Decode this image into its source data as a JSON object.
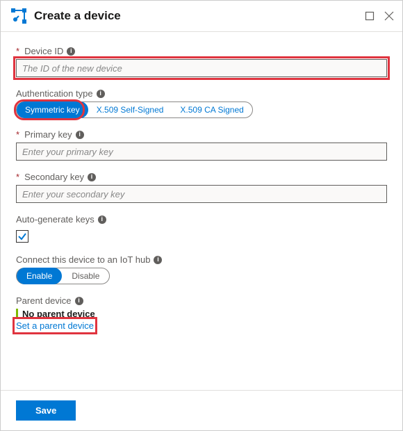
{
  "header": {
    "title": "Create a device"
  },
  "device_id": {
    "label": "Device ID",
    "placeholder": "The ID of the new device",
    "required": true
  },
  "auth_type": {
    "label": "Authentication type",
    "options": [
      "Symmetric key",
      "X.509 Self-Signed",
      "X.509 CA Signed"
    ],
    "selected": "Symmetric key"
  },
  "primary_key": {
    "label": "Primary key",
    "placeholder": "Enter your primary key",
    "required": true
  },
  "secondary_key": {
    "label": "Secondary key",
    "placeholder": "Enter your secondary key",
    "required": true
  },
  "auto_generate": {
    "label": "Auto-generate keys",
    "checked": true
  },
  "connect_hub": {
    "label": "Connect this device to an IoT hub",
    "options": [
      "Enable",
      "Disable"
    ],
    "selected": "Enable"
  },
  "parent_device": {
    "label": "Parent device",
    "value": "No parent device",
    "link": "Set a parent device"
  },
  "footer": {
    "save": "Save"
  }
}
